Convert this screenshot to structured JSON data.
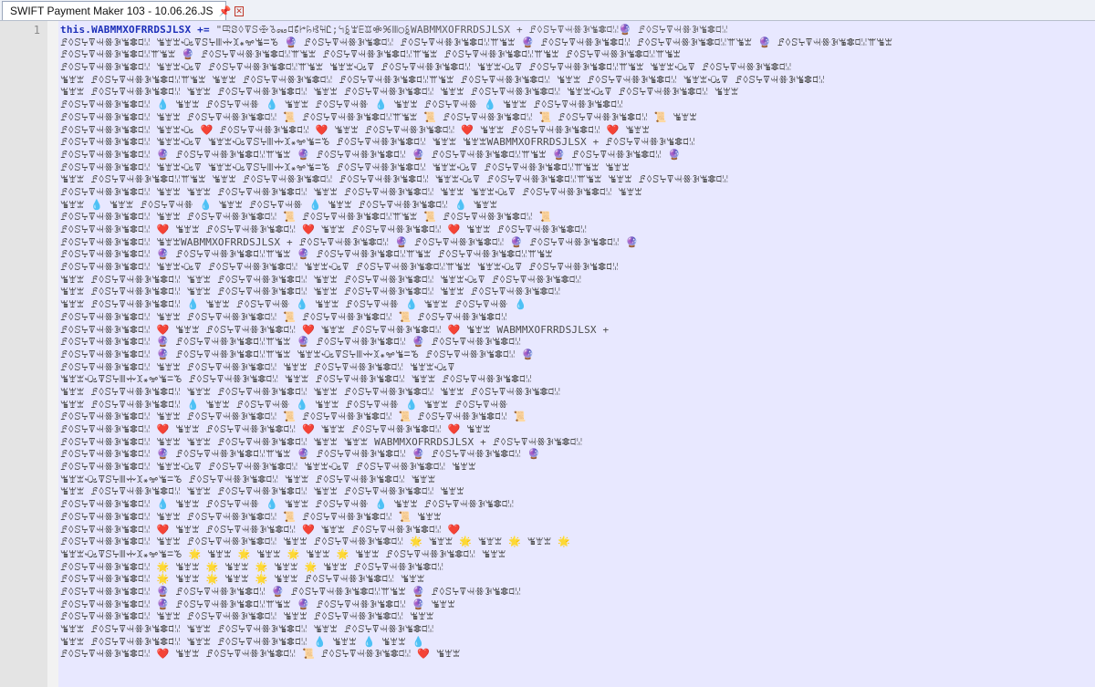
{
  "tab": {
    "title": "SWIFT Payment Maker 103 - 10.06.26.JS",
    "icon": "save-icon",
    "pin_icon": "pin-icon",
    "close_icon": "close-icon"
  },
  "editor": {
    "line_number": "1",
    "first_line": {
      "keyword": "this.",
      "identifier": "WABMMXOFRRDSJLSX",
      "operator": " += ",
      "string_start": "\"ꕓꗟꕺꘜꕶꗾ꘧꘏ꕼ꘦ꔵ꘥ꕙ꘤Ꮭ;ꕪꗐꘆꗋꘑꗂꕑꘈ○ꗐWABMMXOFRRDSJLSX + ꗓꕺꕶꕴꘜꕜꗥꘂꘊꗶꕼꗹ🔮 ꗓꕺꕶꕴꘜꕜꗥꘂꘊꗶꕼꗹ"
    },
    "lines": [
      "ꗓꕺꕶꕴꘜꕜꗥꘂꘊꗶꕼꗹ ꘊꘄꘇꘐꘜꕶꕴꘈꗼꘉ꘎ꗁꘊꘌꘋ 🔮 ꗓꕺꕶꕴꘜꕜꗥꘂꘊꗶꕼꗹ ꗓꕺꕶꕴꘜꕜꗥꘂꘊꗶꕼꗹꕌꘊꘇ 🔮 ꗓꕺꕶꕴꘜꕜꗥꘂꘊꗶꕼꗹ ꗓꕺꕶꕴꘜꕜꗥꘂꘊꗶꕼꗹꕌꘊꘇ 🔮 ꗓꕺꕶꕴꘜꕜꗥꘂꘊꗶꕼꗹꕌꘊꘇ",
      "ꗓꕺꕶꕴꘜꕜꗥꘂꘊꗶꕼꗹꕌꘊꘇ 🔮 ꗓꕺꕶꕴꘜꕜꗥꘂꘊꗶꕼꗹꕌꘊꘇ ꗓꕺꕶꕴꘜꕜꗥꘂꘊꗶꕼꗹꕌꘊꘇ ꗓꕺꕶꕴꘜꕜꗥꘂꘊꗶꕼꗹꕌꘊꘇ ꗓꕺꕶꕴꘜꕜꗥꘂꘊꗶꕼꗹꕌꘊꘇ",
      "ꗓꕺꕶꕴꘜꕜꗥꘂꘊꗶꕼꗹ ꘊꘄꘇꘐꘜ ꗓꕺꕶꕴꘜꕜꗥꘂꘊꗶꕼꗹꕌꘊꘇ ꘊꘄꘇꘐꘜ ꗓꕺꕶꕴꘜꕜꗥꘂꘊꗶꕼꗹ ꘊꘄꘇꘐꘜ ꗓꕺꕶꕴꘜꕜꗥꘂꘊꗶꕼꗹꕌꘊꘇ ꘊꘄꘇꘐꘜ ꗓꕺꕶꕴꘜꕜꗥꘂꘊꗶꕼꗹ",
      "ꘊꘄꘇ ꗓꕺꕶꕴꘜꕜꗥꘂꘊꗶꕼꗹꕌꘊꘇ ꘊꘄꘇ ꗓꕺꕶꕴꘜꕜꗥꘂꘊꗶꕼꗹ ꗓꕺꕶꕴꘜꕜꗥꘂꘊꗶꕼꗹꕌꘊꘇ ꗓꕺꕶꕴꘜꕜꗥꘂꘊꗶꕼꗹ ꘊꘄꘇ ꗓꕺꕶꕴꘜꕜꗥꘂꘊꗶꕼꗹ ꘊꘄꘇꘐꘜ ꗓꕺꕶꕴꘜꕜꗥꘂꘊꗶꕼꗹ",
      "ꘊꘄꘇ ꗓꕺꕶꕴꘜꕜꗥꘂꘊꗶꕼꗹ ꘊꘄꘇ ꗓꕺꕶꕴꘜꕜꗥꘂꘊꗶꕼꗹ ꘊꘄꘇ ꗓꕺꕶꕴꘜꕜꗥꘂꘊꗶꕼꗹ ꘊꘄꘇ ꗓꕺꕶꕴꘜꕜꗥꘂꘊꗶꕼꗹ ꘊꘄꘇꘐꘜ ꗓꕺꕶꕴꘜꕜꗥꘂꘊꗶꕼꗹ ꘊꘄꘇ",
      "ꗓꕺꕶꕴꘜꕜꗥꘂꘊꗶꕼꗹ 💧 ꘊꘄꘇ ꗓꕺꕶꕴꘜꕜꗥ 💧 ꘊꘄꘇ ꗓꕺꕶꕴꘜꕜꗥ 💧 ꘊꘄꘇ ꗓꕺꕶꕴꘜꕜꗥ 💧 ꘊꘄꘇ ꗓꕺꕶꕴꘜꕜꗥꘂꘊꗶꕼꗹ",
      "ꗓꕺꕶꕴꘜꕜꗥꘂꘊꗶꕼꗹ ꘊꘄꘇ ꗓꕺꕶꕴꘜꕜꗥꘂꘊꗶꕼꗹ 📜 ꗓꕺꕶꕴꘜꕜꗥꘂꘊꗶꕼꗹꕌꘊꘇ 📜 ꗓꕺꕶꕴꘜꕜꗥꘂꘊꗶꕼꗹ 📜 ꗓꕺꕶꕴꘜꕜꗥꘂꘊꗶꕼꗹ 📜 ꘊꘄꘇ",
      "ꗓꕺꕶꕴꘜꕜꗥꘂꘊꗶꕼꗹ ꘊꘄꘇꘐ ❤️ ꗓꕺꕶꕴꘜꕜꗥꘂꘊꗶꕼꗹ ❤️ ꘊꘄꘇ ꗓꕺꕶꕴꘜꕜꗥꘂꘊꗶꕼꗹ ❤️ ꘊꘄꘇ ꗓꕺꕶꕴꘜꕜꗥꘂꘊꗶꕼꗹ ❤️ ꘊꘄꘇ",
      "ꗓꕺꕶꕴꘜꕜꗥꘂꘊꗶꕼꗹ ꘊꘄꘇꘐꘜ ꘊꘄꘇꘐꘜꕶꕴꘈꗼꘉ꘎ꗁꘊꘌꘋ ꗓꕺꕶꕴꘜꕜꗥꘂꘊꗶꕼꗹ ꘊꘄꘇ ꘊꘄꘇWABMMXOFRRDSJLSX + ꗓꕺꕶꕴꘜꕜꗥꘂꘊꗶꕼꗹ",
      "ꗓꕺꕶꕴꘜꕜꗥꘂꘊꗶꕼꗹ 🔮 ꗓꕺꕶꕴꘜꕜꗥꘂꘊꗶꕼꗹꕌꘊꘇ 🔮 ꗓꕺꕶꕴꘜꕜꗥꘂꘊꗶꕼꗹ 🔮 ꗓꕺꕶꕴꘜꕜꗥꘂꘊꗶꕼꗹꕌꘊꘇ 🔮 ꗓꕺꕶꕴꘜꕜꗥꘂꘊꗶꕼꗹ 🔮",
      "ꗓꕺꕶꕴꘜꕜꗥꘂꘊꗶꕼꗹ ꘊꘄꘇꘐꘜ ꘊꘄꘇꘐꘜꕶꕴꘈꗼꘉ꘎ꗁꘊꘌꘋ ꗓꕺꕶꕴꘜꕜꗥꘂꘊꗶꕼꗹ ꘊꘄꘇꘐꘜ ꗓꕺꕶꕴꘜꕜꗥꘂꘊꗶꕼꗹꕌꘊꘇ ꘊꘄꘇ",
      "ꘊꘄꘇ ꗓꕺꕶꕴꘜꕜꗥꘂꘊꗶꕼꗹꕌꘊꘇ ꘊꘄꘇ ꗓꕺꕶꕴꘜꕜꗥꘂꘊꗶꕼꗹ ꗓꕺꕶꕴꘜꕜꗥꘂꘊꗶꕼꗹ ꘊꘄꘇꘐꘜ ꗓꕺꕶꕴꘜꕜꗥꘂꘊꗶꕼꗹꕌꘊꘇ ꘊꘄꘇ ꗓꕺꕶꕴꘜꕜꗥꘂꘊꗶꕼꗹ",
      "ꗓꕺꕶꕴꘜꕜꗥꘂꘊꗶꕼꗹ ꘊꘄꘇ ꘊꘄꘇ ꗓꕺꕶꕴꘜꕜꗥꘂꘊꗶꕼꗹ ꘊꘄꘇ ꗓꕺꕶꕴꘜꕜꗥꘂꘊꗶꕼꗹ ꘊꘄꘇ ꘊꘄꘇꘐꘜ ꗓꕺꕶꕴꘜꕜꗥꘂꘊꗶꕼꗹ ꘊꘄꘇ",
      "ꘊꘄꘇ 💧 ꘊꘄꘇ ꗓꕺꕶꕴꘜꕜꗥ 💧 ꘊꘄꘇ ꗓꕺꕶꕴꘜꕜꗥ 💧 ꘊꘄꘇ ꗓꕺꕶꕴꘜꕜꗥꘂꘊꗶꕼꗹ 💧 ꘊꘄꘇ",
      "ꗓꕺꕶꕴꘜꕜꗥꘂꘊꗶꕼꗹ ꘊꘄꘇ ꗓꕺꕶꕴꘜꕜꗥꘂꘊꗶꕼꗹ 📜 ꗓꕺꕶꕴꘜꕜꗥꘂꘊꗶꕼꗹꕌꘊꘇ 📜 ꗓꕺꕶꕴꘜꕜꗥꘂꘊꗶꕼꗹ 📜",
      "ꗓꕺꕶꕴꘜꕜꗥꘂꘊꗶꕼꗹ ❤️ ꘊꘄꘇ ꗓꕺꕶꕴꘜꕜꗥꘂꘊꗶꕼꗹ ❤️ ꘊꘄꘇ ꗓꕺꕶꕴꘜꕜꗥꘂꘊꗶꕼꗹ ❤️ ꘊꘄꘇ ꗓꕺꕶꕴꘜꕜꗥꘂꘊꗶꕼꗹ",
      "ꗓꕺꕶꕴꘜꕜꗥꘂꘊꗶꕼꗹ ꘊꘄꘇWABMMXOFRRDSJLSX + ꗓꕺꕶꕴꘜꕜꗥꘂꘊꗶꕼꗹ 🔮 ꗓꕺꕶꕴꘜꕜꗥꘂꘊꗶꕼꗹ 🔮 ꗓꕺꕶꕴꘜꕜꗥꘂꘊꗶꕼꗹ 🔮",
      "ꗓꕺꕶꕴꘜꕜꗥꘂꘊꗶꕼꗹ 🔮 ꗓꕺꕶꕴꘜꕜꗥꘂꘊꗶꕼꗹꕌꘊꘇ 🔮 ꗓꕺꕶꕴꘜꕜꗥꘂꘊꗶꕼꗹꕌꘊꘇ ꗓꕺꕶꕴꘜꕜꗥꘂꘊꗶꕼꗹꕌꘊꘇ",
      "ꗓꕺꕶꕴꘜꕜꗥꘂꘊꗶꕼꗹ ꘊꘄꘇꘐꘜ ꗓꕺꕶꕴꘜꕜꗥꘂꘊꗶꕼꗹ ꘊꘄꘇꘐꘜ ꗓꕺꕶꕴꘜꕜꗥꘂꘊꗶꕼꗹꕌꘊꘇ ꘊꘄꘇꘐꘜ ꗓꕺꕶꕴꘜꕜꗥꘂꘊꗶꕼꗹ",
      "ꘊꘄꘇ ꗓꕺꕶꕴꘜꕜꗥꘂꘊꗶꕼꗹ ꘊꘄꘇ ꗓꕺꕶꕴꘜꕜꗥꘂꘊꗶꕼꗹ ꘊꘄꘇ ꗓꕺꕶꕴꘜꕜꗥꘂꘊꗶꕼꗹ ꘊꘄꘇꘐꘜ ꗓꕺꕶꕴꘜꕜꗥꘂꘊꗶꕼꗹ",
      "ꘊꘄꘇ ꗓꕺꕶꕴꘜꕜꗥꘂꘊꗶꕼꗹ ꘊꘄꘇ ꗓꕺꕶꕴꘜꕜꗥꘂꘊꗶꕼꗹ ꘊꘄꘇ ꗓꕺꕶꕴꘜꕜꗥꘂꘊꗶꕼꗹ ꘊꘄꘇ ꗓꕺꕶꕴꘜꕜꗥꘂꘊꗶꕼꗹ",
      "ꘊꘄꘇ ꗓꕺꕶꕴꘜꕜꗥꘂꘊꗶꕼꗹ 💧 ꘊꘄꘇ ꗓꕺꕶꕴꘜꕜꗥ 💧 ꘊꘄꘇ ꗓꕺꕶꕴꘜꕜꗥ 💧 ꘊꘄꘇ ꗓꕺꕶꕴꘜꕜꗥ 💧",
      "ꗓꕺꕶꕴꘜꕜꗥꘂꘊꗶꕼꗹ ꘊꘄꘇ ꗓꕺꕶꕴꘜꕜꗥꘂꘊꗶꕼꗹ 📜 ꗓꕺꕶꕴꘜꕜꗥꘂꘊꗶꕼꗹ 📜 ꗓꕺꕶꕴꘜꕜꗥꘂꘊꗶꕼꗹ",
      "ꗓꕺꕶꕴꘜꕜꗥꘂꘊꗶꕼꗹ ❤️ ꘊꘄꘇ ꗓꕺꕶꕴꘜꕜꗥꘂꘊꗶꕼꗹ ❤️ ꘊꘄꘇ ꗓꕺꕶꕴꘜꕜꗥꘂꘊꗶꕼꗹ ❤️ ꘊꘄꘇ WABMMXOFRRDSJLSX +",
      "ꗓꕺꕶꕴꘜꕜꗥꘂꘊꗶꕼꗹ 🔮 ꗓꕺꕶꕴꘜꕜꗥꘂꘊꗶꕼꗹꕌꘊꘇ 🔮 ꗓꕺꕶꕴꘜꕜꗥꘂꘊꗶꕼꗹ 🔮 ꗓꕺꕶꕴꘜꕜꗥꘂꘊꗶꕼꗹ",
      "ꗓꕺꕶꕴꘜꕜꗥꘂꘊꗶꕼꗹ 🔮 ꗓꕺꕶꕴꘜꕜꗥꘂꘊꗶꕼꗹꕌꘊꘇ ꘊꘄꘇꘐꘜꕶꕴꘈꗼꘉ꘎ꗁꘊꘌꘋ ꗓꕺꕶꕴꘜꕜꗥꘂꘊꗶꕼꗹ 🔮",
      "ꗓꕺꕶꕴꘜꕜꗥꘂꘊꗶꕼꗹ ꘊꘄꘇ ꗓꕺꕶꕴꘜꕜꗥꘂꘊꗶꕼꗹ ꘊꘄꘇ ꗓꕺꕶꕴꘜꕜꗥꘂꘊꗶꕼꗹ ꘊꘄꘇꘐꘜ",
      "ꘊꘄꘇꘐꘜꕶꕴꘈꗼꘉ꘎ꗁꘊꘌꘋ ꗓꕺꕶꕴꘜꕜꗥꘂꘊꗶꕼꗹ ꘊꘄꘇ ꗓꕺꕶꕴꘜꕜꗥꘂꘊꗶꕼꗹ ꘊꘄꘇ ꗓꕺꕶꕴꘜꕜꗥꘂꘊꗶꕼꗹ",
      "ꘊꘄꘇ ꗓꕺꕶꕴꘜꕜꗥꘂꘊꗶꕼꗹ ꘊꘄꘇ ꗓꕺꕶꕴꘜꕜꗥꘂꘊꗶꕼꗹ ꘊꘄꘇ ꗓꕺꕶꕴꘜꕜꗥꘂꘊꗶꕼꗹ ꘊꘄꘇ ꗓꕺꕶꕴꘜꕜꗥꘂꘊꗶꕼꗹ",
      "ꘊꘄꘇ ꗓꕺꕶꕴꘜꕜꗥꘂꘊꗶꕼꗹ 💧 ꘊꘄꘇ ꗓꕺꕶꕴꘜꕜꗥ 💧 ꘊꘄꘇ ꗓꕺꕶꕴꘜꕜꗥ 💧 ꘊꘄꘇ ꗓꕺꕶꕴꘜꕜꗥ",
      "ꗓꕺꕶꕴꘜꕜꗥꘂꘊꗶꕼꗹ ꘊꘄꘇ ꗓꕺꕶꕴꘜꕜꗥꘂꘊꗶꕼꗹ 📜 ꗓꕺꕶꕴꘜꕜꗥꘂꘊꗶꕼꗹ 📜 ꗓꕺꕶꕴꘜꕜꗥꘂꘊꗶꕼꗹ 📜",
      "ꗓꕺꕶꕴꘜꕜꗥꘂꘊꗶꕼꗹ ❤️ ꘊꘄꘇ ꗓꕺꕶꕴꘜꕜꗥꘂꘊꗶꕼꗹ ❤️ ꘊꘄꘇ ꗓꕺꕶꕴꘜꕜꗥꘂꘊꗶꕼꗹ ❤️ ꘊꘄꘇ",
      "ꗓꕺꕶꕴꘜꕜꗥꘂꘊꗶꕼꗹ ꘊꘄꘇ ꘊꘄꘇ ꗓꕺꕶꕴꘜꕜꗥꘂꘊꗶꕼꗹ ꘊꘄꘇ ꘊꘄꘇ WABMMXOFRRDSJLSX + ꗓꕺꕶꕴꘜꕜꗥꘂꘊꗶꕼꗹ",
      "ꗓꕺꕶꕴꘜꕜꗥꘂꘊꗶꕼꗹ 🔮 ꗓꕺꕶꕴꘜꕜꗥꘂꘊꗶꕼꗹꕌꘊꘇ 🔮 ꗓꕺꕶꕴꘜꕜꗥꘂꘊꗶꕼꗹ 🔮 ꗓꕺꕶꕴꘜꕜꗥꘂꘊꗶꕼꗹ 🔮",
      "ꗓꕺꕶꕴꘜꕜꗥꘂꘊꗶꕼꗹ ꘊꘄꘇꘐꘜ ꗓꕺꕶꕴꘜꕜꗥꘂꘊꗶꕼꗹ ꘊꘄꘇꘐꘜ ꗓꕺꕶꕴꘜꕜꗥꘂꘊꗶꕼꗹ ꘊꘄꘇ",
      "ꘊꘄꘇꘐꘜꕶꕴꘈꗼꘉ꘎ꗁꘊꘌꘋ ꗓꕺꕶꕴꘜꕜꗥꘂꘊꗶꕼꗹ ꘊꘄꘇ ꗓꕺꕶꕴꘜꕜꗥꘂꘊꗶꕼꗹ ꘊꘄꘇ",
      "ꘊꘄꘇ ꗓꕺꕶꕴꘜꕜꗥꘂꘊꗶꕼꗹ ꘊꘄꘇ ꗓꕺꕶꕴꘜꕜꗥꘂꘊꗶꕼꗹ ꘊꘄꘇ ꗓꕺꕶꕴꘜꕜꗥꘂꘊꗶꕼꗹ ꘊꘄꘇ",
      "ꗓꕺꕶꕴꘜꕜꗥꘂꘊꗶꕼꗹ 💧 ꘊꘄꘇ ꗓꕺꕶꕴꘜꕜꗥ 💧 ꘊꘄꘇ ꗓꕺꕶꕴꘜꕜꗥ 💧 ꘊꘄꘇ ꗓꕺꕶꕴꘜꕜꗥꘂꘊꗶꕼꗹ",
      "ꗓꕺꕶꕴꘜꕜꗥꘂꘊꗶꕼꗹ ꘊꘄꘇ ꗓꕺꕶꕴꘜꕜꗥꘂꘊꗶꕼꗹ 📜 ꗓꕺꕶꕴꘜꕜꗥꘂꘊꗶꕼꗹ 📜 ꘊꘄꘇ",
      "ꗓꕺꕶꕴꘜꕜꗥꘂꘊꗶꕼꗹ ❤️ ꘊꘄꘇ ꗓꕺꕶꕴꘜꕜꗥꘂꘊꗶꕼꗹ ❤️ ꘊꘄꘇ ꗓꕺꕶꕴꘜꕜꗥꘂꘊꗶꕼꗹ ❤️",
      "ꗓꕺꕶꕴꘜꕜꗥꘂꘊꗶꕼꗹ ꘊꘄꘇ ꗓꕺꕶꕴꘜꕜꗥꘂꘊꗶꕼꗹ ꘊꘄꘇ ꗓꕺꕶꕴꘜꕜꗥꘂꘊꗶꕼꗹ 🌟 ꘊꘄꘇ 🌟 ꘊꘄꘇ 🌟 ꘊꘄꘇ 🌟",
      "ꘊꘄꘇꘐꘜꕶꕴꘈꗼꘉ꘎ꗁꘊꘌꘋ 🌟 ꘊꘄꘇ 🌟 ꘊꘄꘇ 🌟 ꘊꘄꘇ 🌟 ꘊꘄꘇ ꗓꕺꕶꕴꘜꕜꗥꘂꘊꗶꕼꗹ ꘊꘄꘇ",
      "ꗓꕺꕶꕴꘜꕜꗥꘂꘊꗶꕼꗹ 🌟 ꘊꘄꘇ 🌟 ꘊꘄꘇ 🌟 ꘊꘄꘇ 🌟 ꘊꘄꘇ ꗓꕺꕶꕴꘜꕜꗥꘂꘊꗶꕼꗹ",
      "ꗓꕺꕶꕴꘜꕜꗥꘂꘊꗶꕼꗹ 🌟 ꘊꘄꘇ 🌟 ꘊꘄꘇ 🌟 ꘊꘄꘇ ꗓꕺꕶꕴꘜꕜꗥꘂꘊꗶꕼꗹ ꘊꘄꘇ",
      "ꗓꕺꕶꕴꘜꕜꗥꘂꘊꗶꕼꗹ 🔮 ꗓꕺꕶꕴꘜꕜꗥꘂꘊꗶꕼꗹ 🔮 ꗓꕺꕶꕴꘜꕜꗥꘂꘊꗶꕼꗹꕌꘊꘇ 🔮 ꗓꕺꕶꕴꘜꕜꗥꘂꘊꗶꕼꗹ",
      "ꗓꕺꕶꕴꘜꕜꗥꘂꘊꗶꕼꗹ 🔮 ꗓꕺꕶꕴꘜꕜꗥꘂꘊꗶꕼꗹꕌꘊꘇ 🔮 ꗓꕺꕶꕴꘜꕜꗥꘂꘊꗶꕼꗹ 🔮 ꘊꘄꘇ",
      "ꗓꕺꕶꕴꘜꕜꗥꘂꘊꗶꕼꗹ ꘊꘄꘇ ꗓꕺꕶꕴꘜꕜꗥꘂꘊꗶꕼꗹ ꘊꘄꘇ ꗓꕺꕶꕴꘜꕜꗥꘂꘊꗶꕼꗹ ꘊꘄꘇ",
      "ꘊꘄꘇ ꗓꕺꕶꕴꘜꕜꗥꘂꘊꗶꕼꗹ ꘊꘄꘇ ꗓꕺꕶꕴꘜꕜꗥꘂꘊꗶꕼꗹ ꘊꘄꘇ ꗓꕺꕶꕴꘜꕜꗥꘂꘊꗶꕼꗹ",
      "ꘊꘄꘇ ꗓꕺꕶꕴꘜꕜꗥꘂꘊꗶꕼꗹ ꘊꘄꘇ ꗓꕺꕶꕴꘜꕜꗥꘂꘊꗶꕼꗹ 💧 ꘊꘄꘇ 💧 ꘊꘄꘇ 💧",
      "ꗓꕺꕶꕴꘜꕜꗥꘂꘊꗶꕼꗹ ❤️ ꘊꘄꘇ ꗓꕺꕶꕴꘜꕜꗥꘂꘊꗶꕼꗹ 📜 ꗓꕺꕶꕴꘜꕜꗥꘂꘊꗶꕼꗹ ❤️ ꘊꘄꘇ"
    ]
  },
  "colors": {
    "editor_bg": "#e8e8ff",
    "keyword": "#1c2fb8",
    "gutter": "#e4e4e4"
  }
}
